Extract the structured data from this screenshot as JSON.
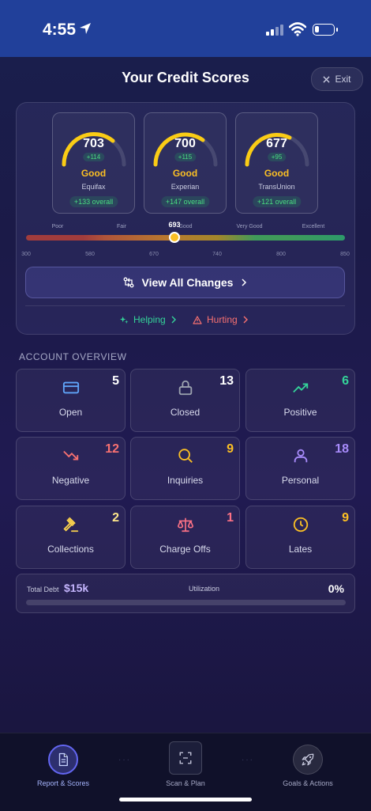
{
  "status": {
    "time": "4:55"
  },
  "header": {
    "title": "Your Credit Scores",
    "exit_label": "Exit"
  },
  "bureaus": [
    {
      "score": "703",
      "delta": "+114",
      "rating": "Good",
      "name": "Equifax",
      "overall": "+133 overall"
    },
    {
      "score": "700",
      "delta": "+115",
      "rating": "Good",
      "name": "Experian",
      "overall": "+147 overall"
    },
    {
      "score": "677",
      "delta": "+95",
      "rating": "Good",
      "name": "TransUnion",
      "overall": "+121 overall"
    }
  ],
  "range": {
    "labels": [
      "Poor",
      "Fair",
      "Good",
      "Very Good",
      "Excellent"
    ],
    "ticks": [
      "300",
      "580",
      "670",
      "740",
      "800",
      "850"
    ],
    "current": "693",
    "current_value": 693,
    "min": 300,
    "max": 850
  },
  "actions": {
    "view_all_label": "View All Changes",
    "helping_label": "Helping",
    "hurting_label": "Hurting"
  },
  "overview": {
    "title": "ACCOUNT OVERVIEW",
    "tiles": [
      {
        "label": "Open",
        "count": "5",
        "icon": "credit-card-icon",
        "color": "#60a5fa",
        "count_color": "#ffffff"
      },
      {
        "label": "Closed",
        "count": "13",
        "icon": "lock-icon",
        "color": "#9ca3af",
        "count_color": "#ffffff"
      },
      {
        "label": "Positive",
        "count": "6",
        "icon": "trending-up-icon",
        "color": "#34d399",
        "count_color": "#34d399"
      },
      {
        "label": "Negative",
        "count": "12",
        "icon": "trending-down-icon",
        "color": "#f87171",
        "count_color": "#f87171"
      },
      {
        "label": "Inquiries",
        "count": "9",
        "icon": "search-icon",
        "color": "#fbbf24",
        "count_color": "#fbbf24"
      },
      {
        "label": "Personal",
        "count": "18",
        "icon": "user-icon",
        "color": "#a78bfa",
        "count_color": "#a78bfa"
      },
      {
        "label": "Collections",
        "count": "2",
        "icon": "gavel-icon",
        "color": "#fcd34d",
        "count_color": "#fde68a"
      },
      {
        "label": "Charge Offs",
        "count": "1",
        "icon": "scale-icon",
        "color": "#fb7185",
        "count_color": "#fb7185"
      },
      {
        "label": "Lates",
        "count": "9",
        "icon": "clock-icon",
        "color": "#fbbf24",
        "count_color": "#fbbf24"
      }
    ]
  },
  "debt": {
    "label": "Total Debt",
    "value": "$15k",
    "utilization_label": "Utilization",
    "utilization_value": "0%",
    "utilization_fraction": 0
  },
  "nav": {
    "items": [
      {
        "label": "Report & Scores",
        "icon": "document-icon",
        "active": true
      },
      {
        "label": "Scan & Plan",
        "icon": "scan-icon",
        "active": false
      },
      {
        "label": "Goals & Actions",
        "icon": "rocket-icon",
        "active": false
      }
    ]
  },
  "colors": {
    "accent": "#6366f1",
    "good": "#fbbf24",
    "positive": "#34d399",
    "negative": "#f87171"
  }
}
